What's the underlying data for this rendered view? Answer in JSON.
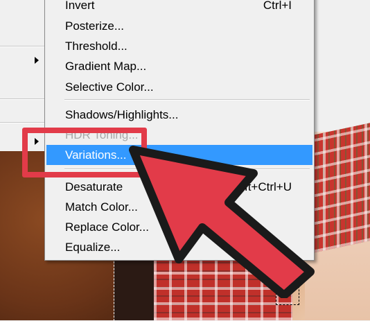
{
  "menu": {
    "items": [
      {
        "label": "Invert",
        "shortcut": "Ctrl+I",
        "state": "normal"
      },
      {
        "label": "Posterize...",
        "shortcut": "",
        "state": "normal"
      },
      {
        "label": "Threshold...",
        "shortcut": "",
        "state": "normal"
      },
      {
        "label": "Gradient Map...",
        "shortcut": "",
        "state": "normal"
      },
      {
        "label": "Selective Color...",
        "shortcut": "",
        "state": "normal"
      },
      {
        "label": "Shadows/Highlights...",
        "shortcut": "",
        "state": "normal"
      },
      {
        "label": "HDR Toning...",
        "shortcut": "",
        "state": "disabled"
      },
      {
        "label": "Variations...",
        "shortcut": "",
        "state": "highlighted"
      },
      {
        "label": "Desaturate",
        "shortcut": "Shift+Ctrl+U",
        "state": "normal"
      },
      {
        "label": "Match Color...",
        "shortcut": "",
        "state": "normal"
      },
      {
        "label": "Replace Color...",
        "shortcut": "",
        "state": "normal"
      },
      {
        "label": "Equalize...",
        "shortcut": "",
        "state": "normal"
      }
    ]
  },
  "colors": {
    "highlight": "#3399ff",
    "annotation_red": "#e23b49",
    "menu_bg": "#f0f0f0"
  },
  "annotations": {
    "highlight_box": "red-rectangle",
    "pointer": "red-arrow-icon"
  }
}
